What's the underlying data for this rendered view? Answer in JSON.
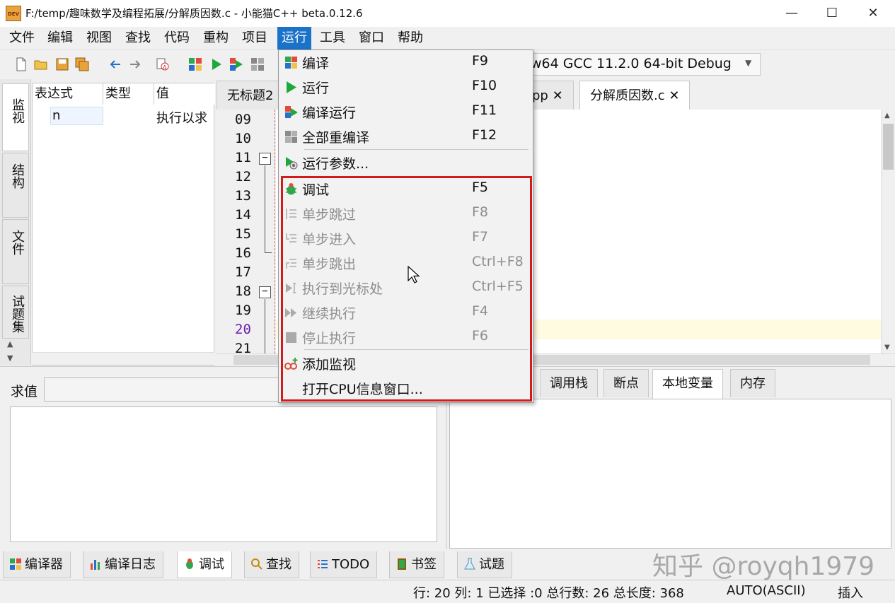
{
  "window": {
    "title": "F:/temp/趣味数学及编程拓展/分解质因数.c - 小能猫C++ beta.0.12.6",
    "app_icon": "DEV",
    "controls": [
      "—",
      "☐",
      "✕"
    ]
  },
  "menubar": [
    "文件",
    "编辑",
    "视图",
    "查找",
    "代码",
    "重构",
    "项目",
    "运行",
    "工具",
    "窗口",
    "帮助"
  ],
  "toolbar": {
    "compiler": "w64 GCC 11.2.0 64-bit Debug"
  },
  "left_tabs": [
    "监视",
    "结构",
    "文件",
    "试题集"
  ],
  "watch": {
    "headers": [
      "表达式",
      "类型",
      "值"
    ],
    "rows": [
      {
        "expr": "n",
        "type": "",
        "value": "执行以求"
      }
    ]
  },
  "editor": {
    "tabs": [
      {
        "label": "无标题2",
        "close": ""
      },
      {
        "label": "pp",
        "close": "✕"
      },
      {
        "label": "分解质因数.c",
        "close": "✕"
      }
    ],
    "line_numbers": [
      "09",
      "10",
      "11",
      "12",
      "13",
      "14",
      "15",
      "16",
      "17",
      "18",
      "19",
      "20",
      "21"
    ],
    "current_line": "20"
  },
  "run_menu": {
    "items": [
      {
        "label": "编译",
        "key": "F9",
        "icon": "compile-icon",
        "enabled": true
      },
      {
        "label": "运行",
        "key": "F10",
        "icon": "run-icon",
        "enabled": true
      },
      {
        "label": "编译运行",
        "key": "F11",
        "icon": "compile-run-icon",
        "enabled": true
      },
      {
        "label": "全部重编译",
        "key": "F12",
        "icon": "rebuild-icon",
        "enabled": true
      },
      {
        "label": "运行参数...",
        "key": "",
        "icon": "run-params-icon",
        "enabled": true
      },
      {
        "label": "调试",
        "key": "F5",
        "icon": "debug-bug-icon",
        "enabled": true
      },
      {
        "label": "单步跳过",
        "key": "F8",
        "icon": "step-over-icon",
        "enabled": false
      },
      {
        "label": "单步进入",
        "key": "F7",
        "icon": "step-into-icon",
        "enabled": false
      },
      {
        "label": "单步跳出",
        "key": "Ctrl+F8",
        "icon": "step-out-icon",
        "enabled": false
      },
      {
        "label": "执行到光标处",
        "key": "Ctrl+F5",
        "icon": "run-to-cursor-icon",
        "enabled": false
      },
      {
        "label": "继续执行",
        "key": "F4",
        "icon": "continue-icon",
        "enabled": false
      },
      {
        "label": "停止执行",
        "key": "F6",
        "icon": "stop-icon",
        "enabled": false
      },
      {
        "label": "添加监视",
        "key": "",
        "icon": "add-watch-icon",
        "enabled": true
      },
      {
        "label": "打开CPU信息窗口...",
        "key": "",
        "icon": "",
        "enabled": true
      }
    ]
  },
  "eval_panel": {
    "label": "求值"
  },
  "debug_tabs": [
    "调用栈",
    "断点",
    "本地变量",
    "内存"
  ],
  "tool_tabs": [
    "编译器",
    "编译日志",
    "调试",
    "查找",
    "TODO",
    "书签",
    "试题"
  ],
  "statusbar": {
    "position": "行: 20 列: 1 已选择 :0 总行数: 26 总长度: 368",
    "encoding": "AUTO(ASCII)",
    "mode": "插入"
  },
  "watermark": "知乎 @royqh1979",
  "colors": {
    "menu_highlight": "#1a72c9",
    "red_box": "#d01c1c"
  }
}
